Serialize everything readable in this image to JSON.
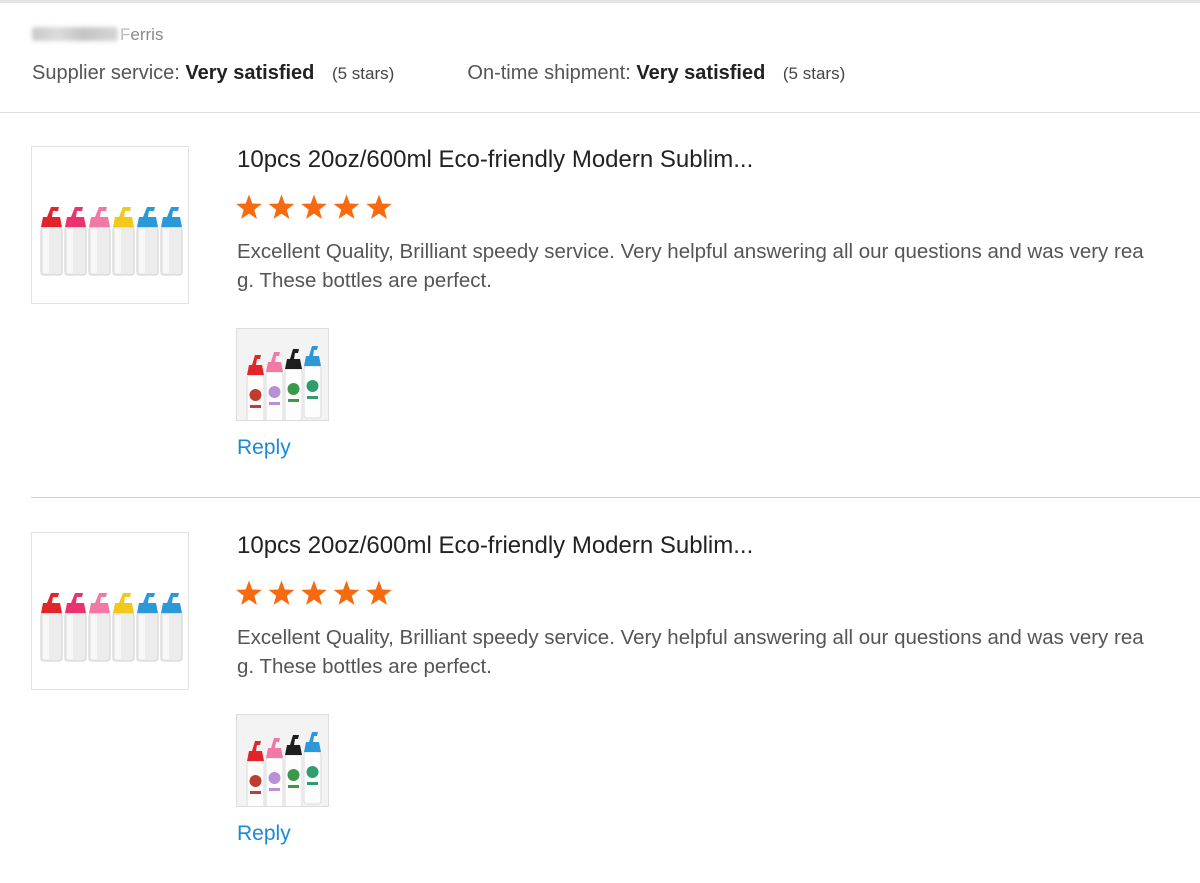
{
  "reviewer": {
    "name_visible": "erris",
    "name_prefix_visible": "F"
  },
  "ratings": {
    "supplier_service_label": "Supplier service:",
    "supplier_service_value": "Very satisfied",
    "supplier_service_stars": "(5 stars)",
    "shipment_label": "On-time shipment:",
    "shipment_value": "Very satisfied",
    "shipment_stars": "(5 stars)"
  },
  "reviews": [
    {
      "product_title": "10pcs 20oz/600ml Eco-friendly Modern Sublim...",
      "star_rating": 5,
      "text_line1": "Excellent Quality, Brilliant speedy service.  Very helpful answering all our questions and was very rea",
      "text_line2": "g.  These bottles are perfect.",
      "reply_label": "Reply"
    },
    {
      "product_title": "10pcs 20oz/600ml Eco-friendly Modern Sublim...",
      "star_rating": 5,
      "text_line1": "Excellent Quality, Brilliant speedy service.  Very helpful answering all our questions and was very rea",
      "text_line2": "g.  These bottles are perfect.",
      "reply_label": "Reply"
    }
  ],
  "colors": {
    "star": "#f76a0f",
    "link": "#1a8ad4",
    "bottle_caps": [
      "#e0262b",
      "#e8336e",
      "#f07aa5",
      "#f2c81a",
      "#2c98d8",
      "#2c98d8"
    ]
  },
  "icons": {
    "star": "star-icon",
    "product_image": "bottles-product-thumbnail",
    "review_photo": "review-photo-thumbnail"
  }
}
